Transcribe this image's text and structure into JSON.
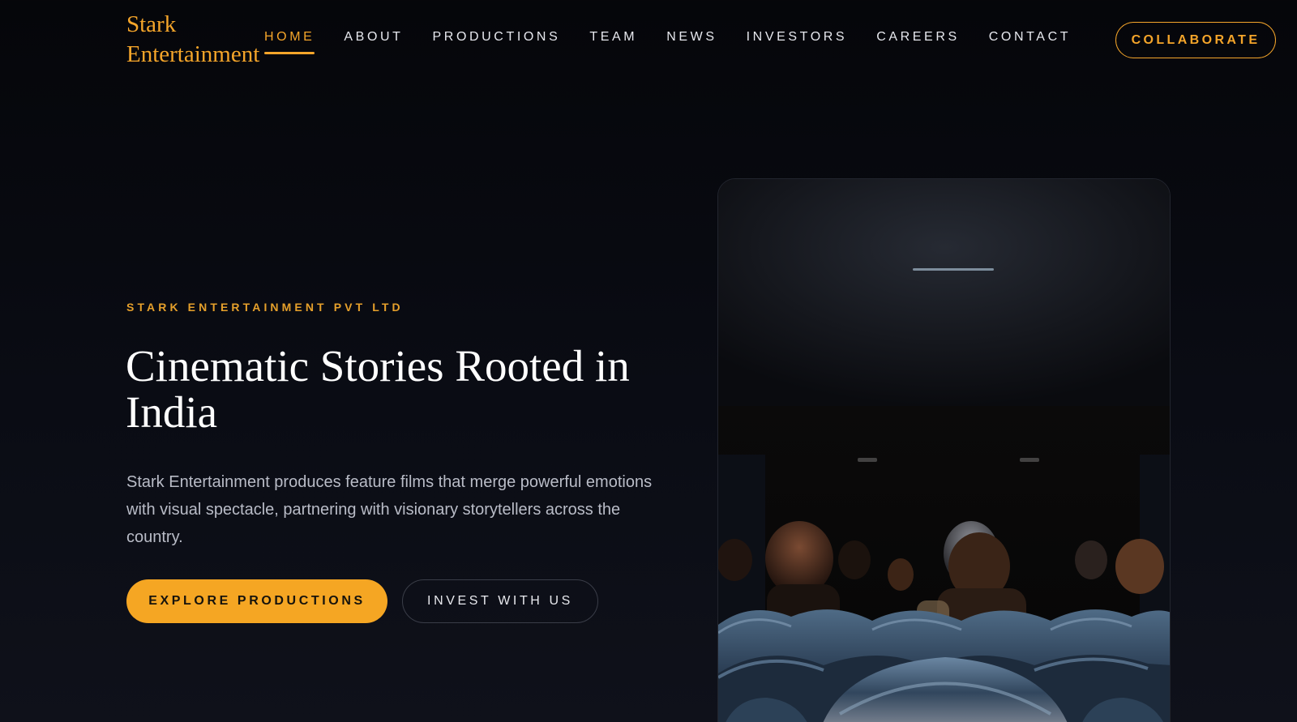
{
  "brand": {
    "line1": "Stark",
    "line2": "Entertainment"
  },
  "nav": {
    "items": [
      {
        "label": "HOME",
        "active": true
      },
      {
        "label": "ABOUT",
        "active": false
      },
      {
        "label": "PRODUCTIONS",
        "active": false
      },
      {
        "label": "TEAM",
        "active": false
      },
      {
        "label": "NEWS",
        "active": false
      },
      {
        "label": "INVESTORS",
        "active": false
      },
      {
        "label": "CAREERS",
        "active": false
      },
      {
        "label": "CONTACT",
        "active": false
      }
    ],
    "cta_label": "COLLABORATE"
  },
  "hero": {
    "eyebrow": "STARK ENTERTAINMENT PVT LTD",
    "headline": "Cinematic Stories Rooted in India",
    "description": "Stark Entertainment produces feature films that merge powerful emotions with visual spectacle, partnering with visionary storytellers across the country.",
    "primary_button": "EXPLORE PRODUCTIONS",
    "secondary_button": "INVEST WITH US"
  },
  "image": {
    "subject": "theater-audience-photo"
  },
  "colors": {
    "accent": "#f5a623",
    "background": "#07080d",
    "text_muted": "#b9bcc7"
  }
}
